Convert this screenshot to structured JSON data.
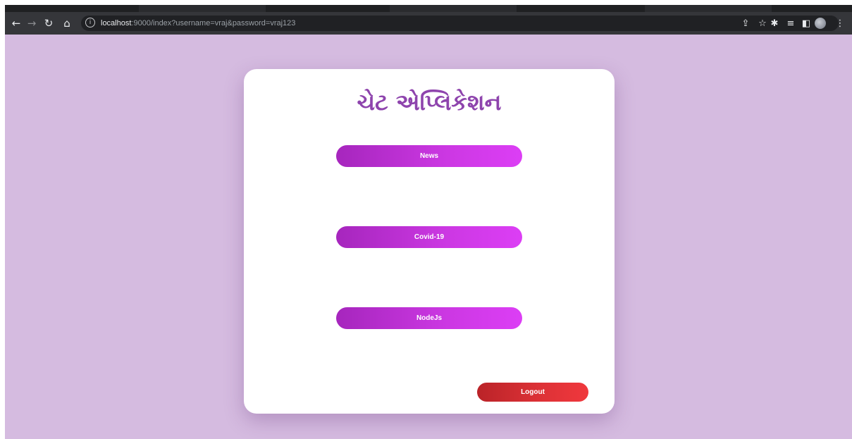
{
  "browser": {
    "url_host": "localhost",
    "url_rest": ":9000/index?username=vraj&password=vraj123",
    "info_glyph": "i",
    "icons": {
      "back": "arrow-left-icon",
      "forward": "arrow-right-icon",
      "reload": "reload-icon",
      "home": "home-icon",
      "share": "share-icon",
      "bookmark": "star-icon",
      "extensions": "puzzle-icon",
      "reading_list": "reading-list-icon",
      "side_panel": "side-panel-icon",
      "profile": "profile-avatar",
      "menu": "kebab-menu-icon"
    }
  },
  "app": {
    "title": "ચેટ એપ્લિકેશન",
    "rooms": [
      {
        "label": "News"
      },
      {
        "label": "Covid-19"
      },
      {
        "label": "NodeJs"
      }
    ],
    "logout_label": "Logout",
    "colors": {
      "background": "#d5bbe0",
      "title": "#8e44ad",
      "room_button_start": "#a626bd",
      "room_button_end": "#dc3ef5",
      "logout_start": "#ba2328",
      "logout_end": "#f0383d"
    }
  }
}
